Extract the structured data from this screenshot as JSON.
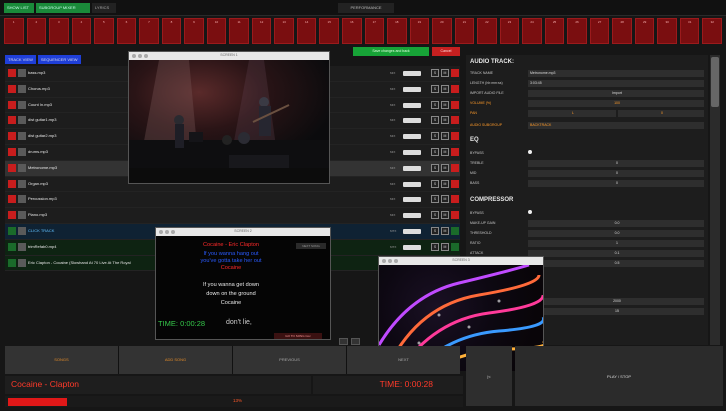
{
  "topbar": {
    "tab_show_list": "SHOW LIST",
    "tab_subgroup_mixer": "SUBGROUP MIXER",
    "tab_lyrics": "LYRICS",
    "performance_label": "PERFORMANCE"
  },
  "pads": [
    "1",
    "2",
    "3",
    "4",
    "5",
    "6",
    "7",
    "8",
    "9",
    "10",
    "11",
    "12",
    "13",
    "14",
    "15",
    "16",
    "17",
    "18",
    "19",
    "20",
    "21",
    "22",
    "23",
    "24",
    "25",
    "26",
    "27",
    "28",
    "29",
    "30",
    "31",
    "32"
  ],
  "views": {
    "track_view": "TRACK VIEW",
    "sequencer_view": "SEQUENCER VIEW"
  },
  "actions": {
    "save": "Save changes and back",
    "cancel": "Cancel"
  },
  "tracks": [
    {
      "name": "bass.mp3",
      "meter": "MIX",
      "type": "normal",
      "sel": false
    },
    {
      "name": "Chorus.mp3",
      "meter": "MIX",
      "type": "normal",
      "sel": false
    },
    {
      "name": "Count In.mp3",
      "meter": "MIX",
      "type": "normal",
      "sel": false
    },
    {
      "name": "dist guitar1.mp3",
      "meter": "MIX",
      "type": "normal",
      "sel": false
    },
    {
      "name": "dist guitar2.mp3",
      "meter": "MIX",
      "type": "normal",
      "sel": false
    },
    {
      "name": "drums.mp3",
      "meter": "MIX",
      "type": "normal",
      "sel": false
    },
    {
      "name": "Metronome.mp3",
      "meter": "MIX",
      "type": "normal",
      "sel": true
    },
    {
      "name": "Organ.mp3",
      "meter": "MIX",
      "type": "normal",
      "sel": false
    },
    {
      "name": "Percussion.mp3",
      "meter": "MIX",
      "type": "normal",
      "sel": false
    },
    {
      "name": "Piano.mp3",
      "meter": "MIX",
      "type": "normal",
      "sel": false
    },
    {
      "name": "CLICK TRACK",
      "meter": "MTX",
      "type": "click",
      "sel": false
    },
    {
      "name": "trimRefab0.mp4",
      "meter": "MTX",
      "type": "green",
      "sel": false
    },
    {
      "name": "Eric Clapton - Cocaine (Slowhand At 70 Live At The Royal",
      "meter": "",
      "type": "green",
      "sel": false
    }
  ],
  "audio_track": {
    "heading": "AUDIO TRACK:",
    "track_name_label": "TRACK NAME",
    "track_name": "Metronome.mp3",
    "length_label": "LENGTH (hh:mm:ss)",
    "length": "3:03:45",
    "import_label": "IMPORT AUDIO FILE",
    "import_value": "Import",
    "volume_label": "VOLUME (%)",
    "volume": "100",
    "pan_label": "PAN",
    "pan_left": "L",
    "pan_value": "0",
    "subgroup_label": "AUDIO SUBGROUP",
    "subgroup": "BACKTRACK"
  },
  "eq": {
    "heading": "EQ",
    "bypass_label": "BYPASS",
    "treble_label": "TREBLE",
    "treble": "0",
    "mid_label": "MID",
    "mid": "0",
    "bass_label": "BASS",
    "bass": "0"
  },
  "compressor": {
    "heading": "COMPRESSOR",
    "bypass_label": "BYPASS",
    "makeup_label": "MAKE-UP GAIN",
    "makeup": "0.0",
    "threshold_label": "THRESHOLD",
    "threshold": "0.0",
    "ratio_label": "RATIO",
    "ratio": "1",
    "attack_label": "ATTACK",
    "attack": "0.1",
    "release_label": "RELEASE",
    "release": "0.5",
    "extra1": "2000",
    "extra2": "15"
  },
  "video_window": {
    "title": "SCREEN 1"
  },
  "lyrics_window": {
    "title": "SCREEN 2",
    "song_title": "Cocaine - Eric Clapton",
    "line_blue1": "If you wanna hang out",
    "line_blue2": "you've gotta take her out",
    "line_red": "Cocaine",
    "line_white1": "If you wanna get down",
    "line_white2": "down on the ground",
    "line_white3": "Cocaine",
    "time_label": "TIME: 0:00:28",
    "trailing": "don't lie,",
    "next_btn": "NEXT SONG",
    "goto_btn": "GO TO SONG Coc"
  },
  "fx_window": {
    "title": "SCREEN 3"
  },
  "controls": {
    "b1": "SONGS",
    "b2": "ADD SONG",
    "b3": "PREVIOUS",
    "b4": "NEXT"
  },
  "now_playing": {
    "title": "Cocaine - Clapton",
    "time": "TIME: 0:00:28",
    "percent": "13%",
    "progress_fraction": 0.13
  },
  "play": {
    "prev_label": "|<",
    "play_stop": "PLAY / STOP"
  },
  "colors": {
    "accent_red": "#c81d1d",
    "accent_green": "#1a8a3a",
    "accent_blue": "#1f3fd8",
    "accent_orange": "#ff9b2a"
  }
}
